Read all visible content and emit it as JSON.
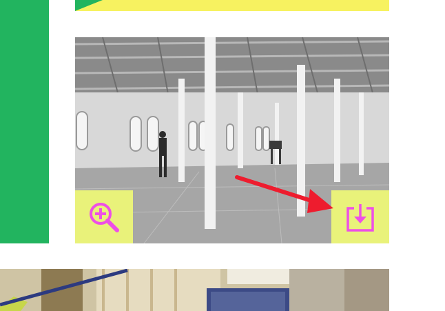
{
  "colors": {
    "accent_green": "#22b45f",
    "banner_yellow": "#f7f260",
    "button_yellow": "#e9f27a",
    "icon_magenta": "#ee4fe6",
    "arrow_red": "#ee1c2e"
  },
  "icons": {
    "zoom": "zoom-in-icon",
    "download": "download-icon",
    "arrow": "red-annotation-arrow"
  }
}
